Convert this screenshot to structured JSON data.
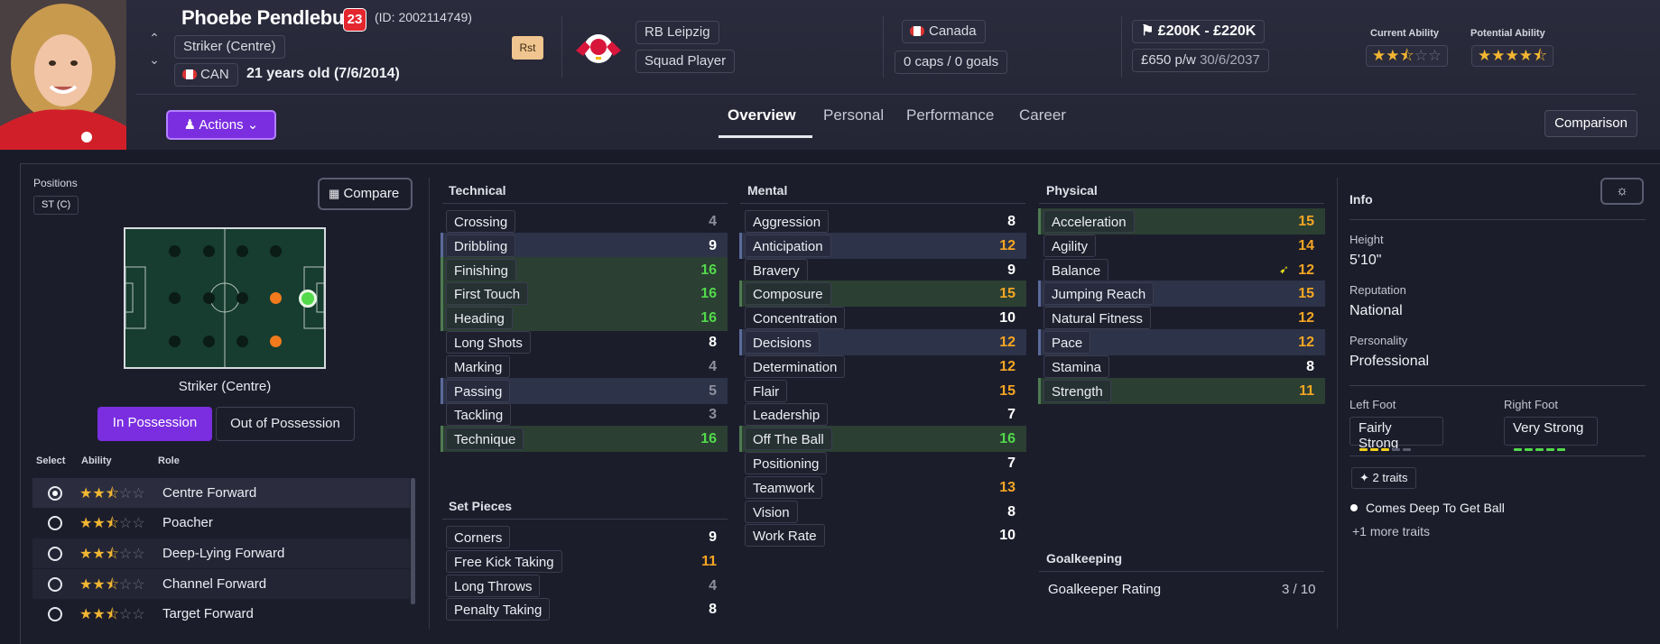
{
  "player": {
    "name": "Phoebe Pendlebury",
    "number": "23",
    "id_text": "(ID: 2002114749)",
    "position": "Striker (Centre)",
    "nation_code": "CAN",
    "age_text": "21 years old (7/6/2014)",
    "role_badge": "Rst"
  },
  "club": {
    "name": "RB Leipzig",
    "status": "Squad Player"
  },
  "nation": {
    "name": "Canada",
    "caps": "0 caps / 0 goals"
  },
  "value": {
    "range": "£200K - £220K",
    "wage": "£650 p/w",
    "contract_end": "30/6/2037"
  },
  "ability": {
    "current_label": "Current Ability",
    "potential_label": "Potential Ability",
    "current_stars": 2.5,
    "potential_stars": 4.5
  },
  "actions_label": "Actions",
  "tabs": [
    "Overview",
    "Personal",
    "Performance",
    "Career"
  ],
  "comparison_label": "Comparison",
  "positions": {
    "title": "Positions",
    "tag": "ST (C)",
    "compare_label": "Compare",
    "pitch_caption": "Striker (Centre)",
    "in_possession": "In Possession",
    "out_possession": "Out of Possession"
  },
  "roles_table": {
    "headers": [
      "Select",
      "Ability",
      "Role"
    ],
    "rows": [
      {
        "role": "Centre Forward",
        "stars": 2.5,
        "selected": true
      },
      {
        "role": "Poacher",
        "stars": 2.5,
        "selected": false
      },
      {
        "role": "Deep-Lying Forward",
        "stars": 2.5,
        "selected": false
      },
      {
        "role": "Channel Forward",
        "stars": 2.5,
        "selected": false
      },
      {
        "role": "Target Forward",
        "stars": 2.5,
        "selected": false
      }
    ]
  },
  "technical": {
    "title": "Technical",
    "attrs": [
      {
        "name": "Crossing",
        "value": "4",
        "hl": ""
      },
      {
        "name": "Dribbling",
        "value": "9",
        "hl": "blue"
      },
      {
        "name": "Finishing",
        "value": "16",
        "hl": "green"
      },
      {
        "name": "First Touch",
        "value": "16",
        "hl": "green"
      },
      {
        "name": "Heading",
        "value": "16",
        "hl": "green"
      },
      {
        "name": "Long Shots",
        "value": "8",
        "hl": ""
      },
      {
        "name": "Marking",
        "value": "4",
        "hl": ""
      },
      {
        "name": "Passing",
        "value": "5",
        "hl": "blue"
      },
      {
        "name": "Tackling",
        "value": "3",
        "hl": ""
      },
      {
        "name": "Technique",
        "value": "16",
        "hl": "green"
      }
    ]
  },
  "set_pieces": {
    "title": "Set Pieces",
    "attrs": [
      {
        "name": "Corners",
        "value": "9",
        "hl": ""
      },
      {
        "name": "Free Kick Taking",
        "value": "11",
        "hl": ""
      },
      {
        "name": "Long Throws",
        "value": "4",
        "hl": ""
      },
      {
        "name": "Penalty Taking",
        "value": "8",
        "hl": ""
      }
    ]
  },
  "mental": {
    "title": "Mental",
    "attrs": [
      {
        "name": "Aggression",
        "value": "8",
        "hl": ""
      },
      {
        "name": "Anticipation",
        "value": "12",
        "hl": "blue"
      },
      {
        "name": "Bravery",
        "value": "9",
        "hl": ""
      },
      {
        "name": "Composure",
        "value": "15",
        "hl": "green"
      },
      {
        "name": "Concentration",
        "value": "10",
        "hl": ""
      },
      {
        "name": "Decisions",
        "value": "12",
        "hl": "blue"
      },
      {
        "name": "Determination",
        "value": "12",
        "hl": ""
      },
      {
        "name": "Flair",
        "value": "15",
        "hl": ""
      },
      {
        "name": "Leadership",
        "value": "7",
        "hl": ""
      },
      {
        "name": "Off The Ball",
        "value": "16",
        "hl": "green"
      },
      {
        "name": "Positioning",
        "value": "7",
        "hl": ""
      },
      {
        "name": "Teamwork",
        "value": "13",
        "hl": ""
      },
      {
        "name": "Vision",
        "value": "8",
        "hl": ""
      },
      {
        "name": "Work Rate",
        "value": "10",
        "hl": ""
      }
    ]
  },
  "physical": {
    "title": "Physical",
    "attrs": [
      {
        "name": "Acceleration",
        "value": "15",
        "hl": "green"
      },
      {
        "name": "Agility",
        "value": "14",
        "hl": ""
      },
      {
        "name": "Balance",
        "value": "12",
        "hl": ""
      },
      {
        "name": "Jumping Reach",
        "value": "15",
        "hl": "blue"
      },
      {
        "name": "Natural Fitness",
        "value": "12",
        "hl": ""
      },
      {
        "name": "Pace",
        "value": "12",
        "hl": "blue"
      },
      {
        "name": "Stamina",
        "value": "8",
        "hl": ""
      },
      {
        "name": "Strength",
        "value": "11",
        "hl": "green"
      }
    ]
  },
  "goalkeeping": {
    "title": "Goalkeeping",
    "label": "Goalkeeper Rating",
    "value": "3 / 10"
  },
  "info": {
    "title": "Info",
    "height_label": "Height",
    "height": "5'10\"",
    "reputation_label": "Reputation",
    "reputation": "National",
    "personality_label": "Personality",
    "personality": "Professional",
    "left_foot_label": "Left Foot",
    "left_foot": "Fairly Strong",
    "right_foot_label": "Right Foot",
    "right_foot": "Very Strong",
    "traits_count": "2 traits",
    "trait_1": "Comes Deep To Get Ball",
    "more_traits": "+1 more traits"
  },
  "colors": {
    "accent": "#7a2ee0",
    "orange": "#f5a623",
    "green": "#52d94a",
    "highlight_green": "#2b3f33",
    "highlight_blue": "#2d3348"
  }
}
